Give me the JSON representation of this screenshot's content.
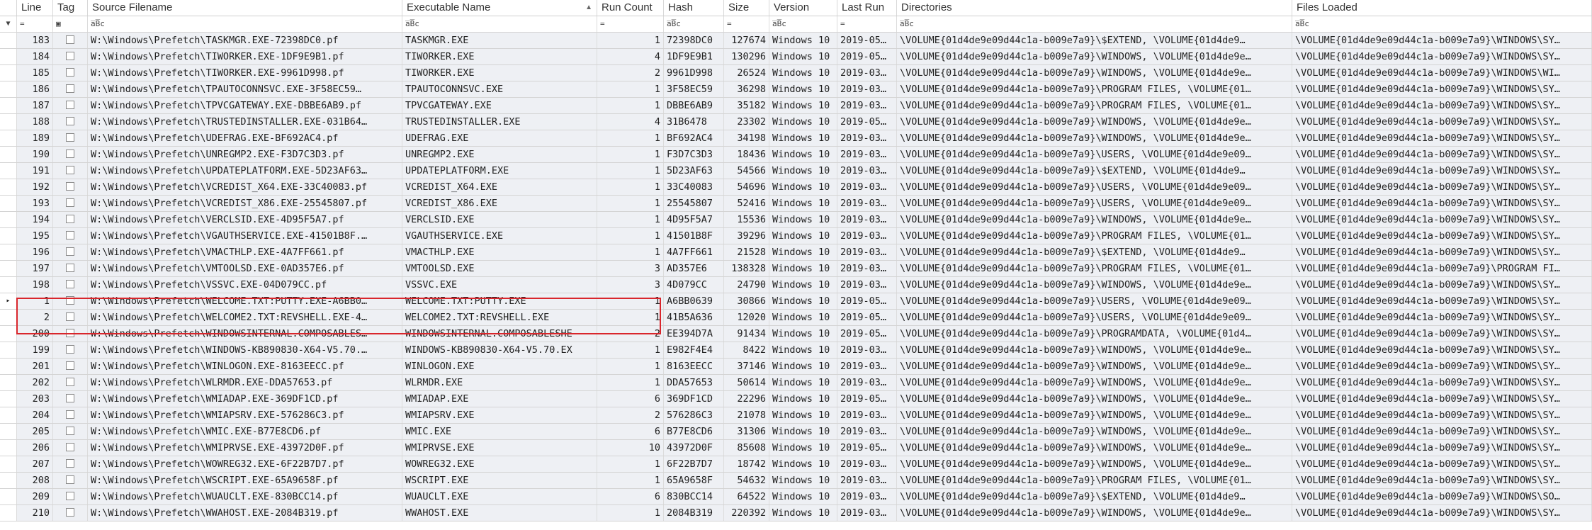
{
  "columns": {
    "line": "Line",
    "tag": "Tag",
    "source": "Source Filename",
    "exe": "Executable Name",
    "runcount": "Run Count",
    "hash": "Hash",
    "size": "Size",
    "version": "Version",
    "lastrun": "Last Run",
    "dirs": "Directories",
    "files": "Files Loaded"
  },
  "filters": {
    "line": "=",
    "tag": "▣",
    "source": "a̅B̅c",
    "exe": "a̅B̅c",
    "runcount": "=",
    "hash": "a̅B̅c",
    "size": "=",
    "version": "a̅B̅c",
    "lastrun": "=",
    "dirs": "a̅B̅c",
    "files": "a̅B̅c"
  },
  "filter_icon": "funnel-icon",
  "rows": [
    {
      "line": "183",
      "src": "W:\\Windows\\Prefetch\\TASKMGR.EXE-72398DC0.pf",
      "exe": "TASKMGR.EXE",
      "rc": "1",
      "hash": "72398DC0",
      "size": "127674",
      "ver": "Windows 10",
      "run": "2019-05…",
      "dirs": "\\VOLUME{01d4de9e09d44c1a-b009e7a9}\\$EXTEND, \\VOLUME{01d4de9…",
      "files": "\\VOLUME{01d4de9e09d44c1a-b009e7a9}\\WINDOWS\\SY…"
    },
    {
      "line": "184",
      "src": "W:\\Windows\\Prefetch\\TIWORKER.EXE-1DF9E9B1.pf",
      "exe": "TIWORKER.EXE",
      "rc": "4",
      "hash": "1DF9E9B1",
      "size": "130296",
      "ver": "Windows 10",
      "run": "2019-05…",
      "dirs": "\\VOLUME{01d4de9e09d44c1a-b009e7a9}\\WINDOWS, \\VOLUME{01d4de9e…",
      "files": "\\VOLUME{01d4de9e09d44c1a-b009e7a9}\\WINDOWS\\SY…"
    },
    {
      "line": "185",
      "src": "W:\\Windows\\Prefetch\\TIWORKER.EXE-9961D998.pf",
      "exe": "TIWORKER.EXE",
      "rc": "2",
      "hash": "9961D998",
      "size": "26524",
      "ver": "Windows 10",
      "run": "2019-03…",
      "dirs": "\\VOLUME{01d4de9e09d44c1a-b009e7a9}\\WINDOWS, \\VOLUME{01d4de9e…",
      "files": "\\VOLUME{01d4de9e09d44c1a-b009e7a9}\\WINDOWS\\WI…"
    },
    {
      "line": "186",
      "src": "W:\\Windows\\Prefetch\\TPAUTOCONNSVC.EXE-3F58EC59…",
      "exe": "TPAUTOCONNSVC.EXE",
      "rc": "1",
      "hash": "3F58EC59",
      "size": "36298",
      "ver": "Windows 10",
      "run": "2019-03…",
      "dirs": "\\VOLUME{01d4de9e09d44c1a-b009e7a9}\\PROGRAM FILES, \\VOLUME{01…",
      "files": "\\VOLUME{01d4de9e09d44c1a-b009e7a9}\\WINDOWS\\SY…"
    },
    {
      "line": "187",
      "src": "W:\\Windows\\Prefetch\\TPVCGATEWAY.EXE-DBBE6AB9.pf",
      "exe": "TPVCGATEWAY.EXE",
      "rc": "1",
      "hash": "DBBE6AB9",
      "size": "35182",
      "ver": "Windows 10",
      "run": "2019-03…",
      "dirs": "\\VOLUME{01d4de9e09d44c1a-b009e7a9}\\PROGRAM FILES, \\VOLUME{01…",
      "files": "\\VOLUME{01d4de9e09d44c1a-b009e7a9}\\WINDOWS\\SY…"
    },
    {
      "line": "188",
      "src": "W:\\Windows\\Prefetch\\TRUSTEDINSTALLER.EXE-031B64…",
      "exe": "TRUSTEDINSTALLER.EXE",
      "rc": "4",
      "hash": "31B6478",
      "size": "23302",
      "ver": "Windows 10",
      "run": "2019-05…",
      "dirs": "\\VOLUME{01d4de9e09d44c1a-b009e7a9}\\WINDOWS, \\VOLUME{01d4de9e…",
      "files": "\\VOLUME{01d4de9e09d44c1a-b009e7a9}\\WINDOWS\\SY…"
    },
    {
      "line": "189",
      "src": "W:\\Windows\\Prefetch\\UDEFRAG.EXE-BF692AC4.pf",
      "exe": "UDEFRAG.EXE",
      "rc": "1",
      "hash": "BF692AC4",
      "size": "34198",
      "ver": "Windows 10",
      "run": "2019-03…",
      "dirs": "\\VOLUME{01d4de9e09d44c1a-b009e7a9}\\WINDOWS, \\VOLUME{01d4de9e…",
      "files": "\\VOLUME{01d4de9e09d44c1a-b009e7a9}\\WINDOWS\\SY…"
    },
    {
      "line": "190",
      "src": "W:\\Windows\\Prefetch\\UNREGMP2.EXE-F3D7C3D3.pf",
      "exe": "UNREGMP2.EXE",
      "rc": "1",
      "hash": "F3D7C3D3",
      "size": "18436",
      "ver": "Windows 10",
      "run": "2019-03…",
      "dirs": "\\VOLUME{01d4de9e09d44c1a-b009e7a9}\\USERS, \\VOLUME{01d4de9e09…",
      "files": "\\VOLUME{01d4de9e09d44c1a-b009e7a9}\\WINDOWS\\SY…"
    },
    {
      "line": "191",
      "src": "W:\\Windows\\Prefetch\\UPDATEPLATFORM.EXE-5D23AF63…",
      "exe": "UPDATEPLATFORM.EXE",
      "rc": "1",
      "hash": "5D23AF63",
      "size": "54566",
      "ver": "Windows 10",
      "run": "2019-03…",
      "dirs": "\\VOLUME{01d4de9e09d44c1a-b009e7a9}\\$EXTEND, \\VOLUME{01d4de9…",
      "files": "\\VOLUME{01d4de9e09d44c1a-b009e7a9}\\WINDOWS\\SY…"
    },
    {
      "line": "192",
      "src": "W:\\Windows\\Prefetch\\VCREDIST_X64.EXE-33C40083.pf",
      "exe": "VCREDIST_X64.EXE",
      "rc": "1",
      "hash": "33C40083",
      "size": "54696",
      "ver": "Windows 10",
      "run": "2019-03…",
      "dirs": "\\VOLUME{01d4de9e09d44c1a-b009e7a9}\\USERS, \\VOLUME{01d4de9e09…",
      "files": "\\VOLUME{01d4de9e09d44c1a-b009e7a9}\\WINDOWS\\SY…"
    },
    {
      "line": "193",
      "src": "W:\\Windows\\Prefetch\\VCREDIST_X86.EXE-25545807.pf",
      "exe": "VCREDIST_X86.EXE",
      "rc": "1",
      "hash": "25545807",
      "size": "52416",
      "ver": "Windows 10",
      "run": "2019-03…",
      "dirs": "\\VOLUME{01d4de9e09d44c1a-b009e7a9}\\USERS, \\VOLUME{01d4de9e09…",
      "files": "\\VOLUME{01d4de9e09d44c1a-b009e7a9}\\WINDOWS\\SY…"
    },
    {
      "line": "194",
      "src": "W:\\Windows\\Prefetch\\VERCLSID.EXE-4D95F5A7.pf",
      "exe": "VERCLSID.EXE",
      "rc": "1",
      "hash": "4D95F5A7",
      "size": "15536",
      "ver": "Windows 10",
      "run": "2019-03…",
      "dirs": "\\VOLUME{01d4de9e09d44c1a-b009e7a9}\\WINDOWS, \\VOLUME{01d4de9e…",
      "files": "\\VOLUME{01d4de9e09d44c1a-b009e7a9}\\WINDOWS\\SY…"
    },
    {
      "line": "195",
      "src": "W:\\Windows\\Prefetch\\VGAUTHSERVICE.EXE-41501B8F.…",
      "exe": "VGAUTHSERVICE.EXE",
      "rc": "1",
      "hash": "41501B8F",
      "size": "39296",
      "ver": "Windows 10",
      "run": "2019-03…",
      "dirs": "\\VOLUME{01d4de9e09d44c1a-b009e7a9}\\PROGRAM FILES, \\VOLUME{01…",
      "files": "\\VOLUME{01d4de9e09d44c1a-b009e7a9}\\WINDOWS\\SY…"
    },
    {
      "line": "196",
      "src": "W:\\Windows\\Prefetch\\VMACTHLP.EXE-4A7FF661.pf",
      "exe": "VMACTHLP.EXE",
      "rc": "1",
      "hash": "4A7FF661",
      "size": "21528",
      "ver": "Windows 10",
      "run": "2019-03…",
      "dirs": "\\VOLUME{01d4de9e09d44c1a-b009e7a9}\\$EXTEND, \\VOLUME{01d4de9…",
      "files": "\\VOLUME{01d4de9e09d44c1a-b009e7a9}\\WINDOWS\\SY…"
    },
    {
      "line": "197",
      "src": "W:\\Windows\\Prefetch\\VMTOOLSD.EXE-0AD357E6.pf",
      "exe": "VMTOOLSD.EXE",
      "rc": "3",
      "hash": "AD357E6",
      "size": "138328",
      "ver": "Windows 10",
      "run": "2019-03…",
      "dirs": "\\VOLUME{01d4de9e09d44c1a-b009e7a9}\\PROGRAM FILES, \\VOLUME{01…",
      "files": "\\VOLUME{01d4de9e09d44c1a-b009e7a9}\\PROGRAM FI…"
    },
    {
      "line": "198",
      "src": "W:\\Windows\\Prefetch\\VSSVC.EXE-04D079CC.pf",
      "exe": "VSSVC.EXE",
      "rc": "3",
      "hash": "4D079CC",
      "size": "24790",
      "ver": "Windows 10",
      "run": "2019-03…",
      "dirs": "\\VOLUME{01d4de9e09d44c1a-b009e7a9}\\WINDOWS, \\VOLUME{01d4de9e…",
      "files": "\\VOLUME{01d4de9e09d44c1a-b009e7a9}\\WINDOWS\\SY…"
    },
    {
      "line": "1",
      "ptr": true,
      "src": "W:\\Windows\\Prefetch\\WELCOME.TXT:PUTTY.EXE-A6BB0…",
      "exe": "WELCOME.TXT:PUTTY.EXE",
      "rc": "1",
      "hash": "A6BB0639",
      "size": "30866",
      "ver": "Windows 10",
      "run": "2019-05…",
      "dirs": "\\VOLUME{01d4de9e09d44c1a-b009e7a9}\\USERS, \\VOLUME{01d4de9e09…",
      "files": "\\VOLUME{01d4de9e09d44c1a-b009e7a9}\\WINDOWS\\SY…"
    },
    {
      "line": "2",
      "src": "W:\\Windows\\Prefetch\\WELCOME2.TXT:REVSHELL.EXE-4…",
      "exe": "WELCOME2.TXT:REVSHELL.EXE",
      "rc": "1",
      "hash": "41B5A636",
      "size": "12020",
      "ver": "Windows 10",
      "run": "2019-05…",
      "dirs": "\\VOLUME{01d4de9e09d44c1a-b009e7a9}\\USERS, \\VOLUME{01d4de9e09…",
      "files": "\\VOLUME{01d4de9e09d44c1a-b009e7a9}\\WINDOWS\\SY…"
    },
    {
      "line": "200",
      "src": "W:\\Windows\\Prefetch\\WINDOWSINTERNAL.COMPOSABLES…",
      "exe": "WINDOWSINTERNAL.COMPOSABLESHE",
      "rc": "2",
      "hash": "EE394D7A",
      "size": "91434",
      "ver": "Windows 10",
      "run": "2019-05…",
      "dirs": "\\VOLUME{01d4de9e09d44c1a-b009e7a9}\\PROGRAMDATA, \\VOLUME{01d4…",
      "files": "\\VOLUME{01d4de9e09d44c1a-b009e7a9}\\WINDOWS\\SY…"
    },
    {
      "line": "199",
      "src": "W:\\Windows\\Prefetch\\WINDOWS-KB890830-X64-V5.70.…",
      "exe": "WINDOWS-KB890830-X64-V5.70.EX",
      "rc": "1",
      "hash": "E982F4E4",
      "size": "8422",
      "ver": "Windows 10",
      "run": "2019-03…",
      "dirs": "\\VOLUME{01d4de9e09d44c1a-b009e7a9}\\WINDOWS, \\VOLUME{01d4de9e…",
      "files": "\\VOLUME{01d4de9e09d44c1a-b009e7a9}\\WINDOWS\\SY…"
    },
    {
      "line": "201",
      "src": "W:\\Windows\\Prefetch\\WINLOGON.EXE-8163EECC.pf",
      "exe": "WINLOGON.EXE",
      "rc": "1",
      "hash": "8163EECC",
      "size": "37146",
      "ver": "Windows 10",
      "run": "2019-03…",
      "dirs": "\\VOLUME{01d4de9e09d44c1a-b009e7a9}\\WINDOWS, \\VOLUME{01d4de9e…",
      "files": "\\VOLUME{01d4de9e09d44c1a-b009e7a9}\\WINDOWS\\SY…"
    },
    {
      "line": "202",
      "src": "W:\\Windows\\Prefetch\\WLRMDR.EXE-DDA57653.pf",
      "exe": "WLRMDR.EXE",
      "rc": "1",
      "hash": "DDA57653",
      "size": "50614",
      "ver": "Windows 10",
      "run": "2019-03…",
      "dirs": "\\VOLUME{01d4de9e09d44c1a-b009e7a9}\\WINDOWS, \\VOLUME{01d4de9e…",
      "files": "\\VOLUME{01d4de9e09d44c1a-b009e7a9}\\WINDOWS\\SY…"
    },
    {
      "line": "203",
      "src": "W:\\Windows\\Prefetch\\WMIADAP.EXE-369DF1CD.pf",
      "exe": "WMIADAP.EXE",
      "rc": "6",
      "hash": "369DF1CD",
      "size": "22296",
      "ver": "Windows 10",
      "run": "2019-05…",
      "dirs": "\\VOLUME{01d4de9e09d44c1a-b009e7a9}\\WINDOWS, \\VOLUME{01d4de9e…",
      "files": "\\VOLUME{01d4de9e09d44c1a-b009e7a9}\\WINDOWS\\SY…"
    },
    {
      "line": "204",
      "src": "W:\\Windows\\Prefetch\\WMIAPSRV.EXE-576286C3.pf",
      "exe": "WMIAPSRV.EXE",
      "rc": "2",
      "hash": "576286C3",
      "size": "21078",
      "ver": "Windows 10",
      "run": "2019-03…",
      "dirs": "\\VOLUME{01d4de9e09d44c1a-b009e7a9}\\WINDOWS, \\VOLUME{01d4de9e…",
      "files": "\\VOLUME{01d4de9e09d44c1a-b009e7a9}\\WINDOWS\\SY…"
    },
    {
      "line": "205",
      "src": "W:\\Windows\\Prefetch\\WMIC.EXE-B77E8CD6.pf",
      "exe": "WMIC.EXE",
      "rc": "6",
      "hash": "B77E8CD6",
      "size": "31306",
      "ver": "Windows 10",
      "run": "2019-03…",
      "dirs": "\\VOLUME{01d4de9e09d44c1a-b009e7a9}\\WINDOWS, \\VOLUME{01d4de9e…",
      "files": "\\VOLUME{01d4de9e09d44c1a-b009e7a9}\\WINDOWS\\SY…"
    },
    {
      "line": "206",
      "src": "W:\\Windows\\Prefetch\\WMIPRVSE.EXE-43972D0F.pf",
      "exe": "WMIPRVSE.EXE",
      "rc": "10",
      "hash": "43972D0F",
      "size": "85608",
      "ver": "Windows 10",
      "run": "2019-05…",
      "dirs": "\\VOLUME{01d4de9e09d44c1a-b009e7a9}\\WINDOWS, \\VOLUME{01d4de9e…",
      "files": "\\VOLUME{01d4de9e09d44c1a-b009e7a9}\\WINDOWS\\SY…"
    },
    {
      "line": "207",
      "src": "W:\\Windows\\Prefetch\\WOWREG32.EXE-6F22B7D7.pf",
      "exe": "WOWREG32.EXE",
      "rc": "1",
      "hash": "6F22B7D7",
      "size": "18742",
      "ver": "Windows 10",
      "run": "2019-03…",
      "dirs": "\\VOLUME{01d4de9e09d44c1a-b009e7a9}\\WINDOWS, \\VOLUME{01d4de9e…",
      "files": "\\VOLUME{01d4de9e09d44c1a-b009e7a9}\\WINDOWS\\SY…"
    },
    {
      "line": "208",
      "src": "W:\\Windows\\Prefetch\\WSCRIPT.EXE-65A9658F.pf",
      "exe": "WSCRIPT.EXE",
      "rc": "1",
      "hash": "65A9658F",
      "size": "54632",
      "ver": "Windows 10",
      "run": "2019-03…",
      "dirs": "\\VOLUME{01d4de9e09d44c1a-b009e7a9}\\PROGRAM FILES, \\VOLUME{01…",
      "files": "\\VOLUME{01d4de9e09d44c1a-b009e7a9}\\WINDOWS\\SY…"
    },
    {
      "line": "209",
      "src": "W:\\Windows\\Prefetch\\WUAUCLT.EXE-830BCC14.pf",
      "exe": "WUAUCLT.EXE",
      "rc": "6",
      "hash": "830BCC14",
      "size": "64522",
      "ver": "Windows 10",
      "run": "2019-03…",
      "dirs": "\\VOLUME{01d4de9e09d44c1a-b009e7a9}\\$EXTEND, \\VOLUME{01d4de9…",
      "files": "\\VOLUME{01d4de9e09d44c1a-b009e7a9}\\WINDOWS\\SO…"
    },
    {
      "line": "210",
      "src": "W:\\Windows\\Prefetch\\WWAHOST.EXE-2084B319.pf",
      "exe": "WWAHOST.EXE",
      "rc": "1",
      "hash": "2084B319",
      "size": "220392",
      "ver": "Windows 10",
      "run": "2019-03…",
      "dirs": "\\VOLUME{01d4de9e09d44c1a-b009e7a9}\\WINDOWS, \\VOLUME{01d4de9e…",
      "files": "\\VOLUME{01d4de9e09d44c1a-b009e7a9}\\WINDOWS\\SY…"
    }
  ],
  "colors": {
    "highlight": "#d9262c",
    "row_bg": "#eef0f4"
  }
}
